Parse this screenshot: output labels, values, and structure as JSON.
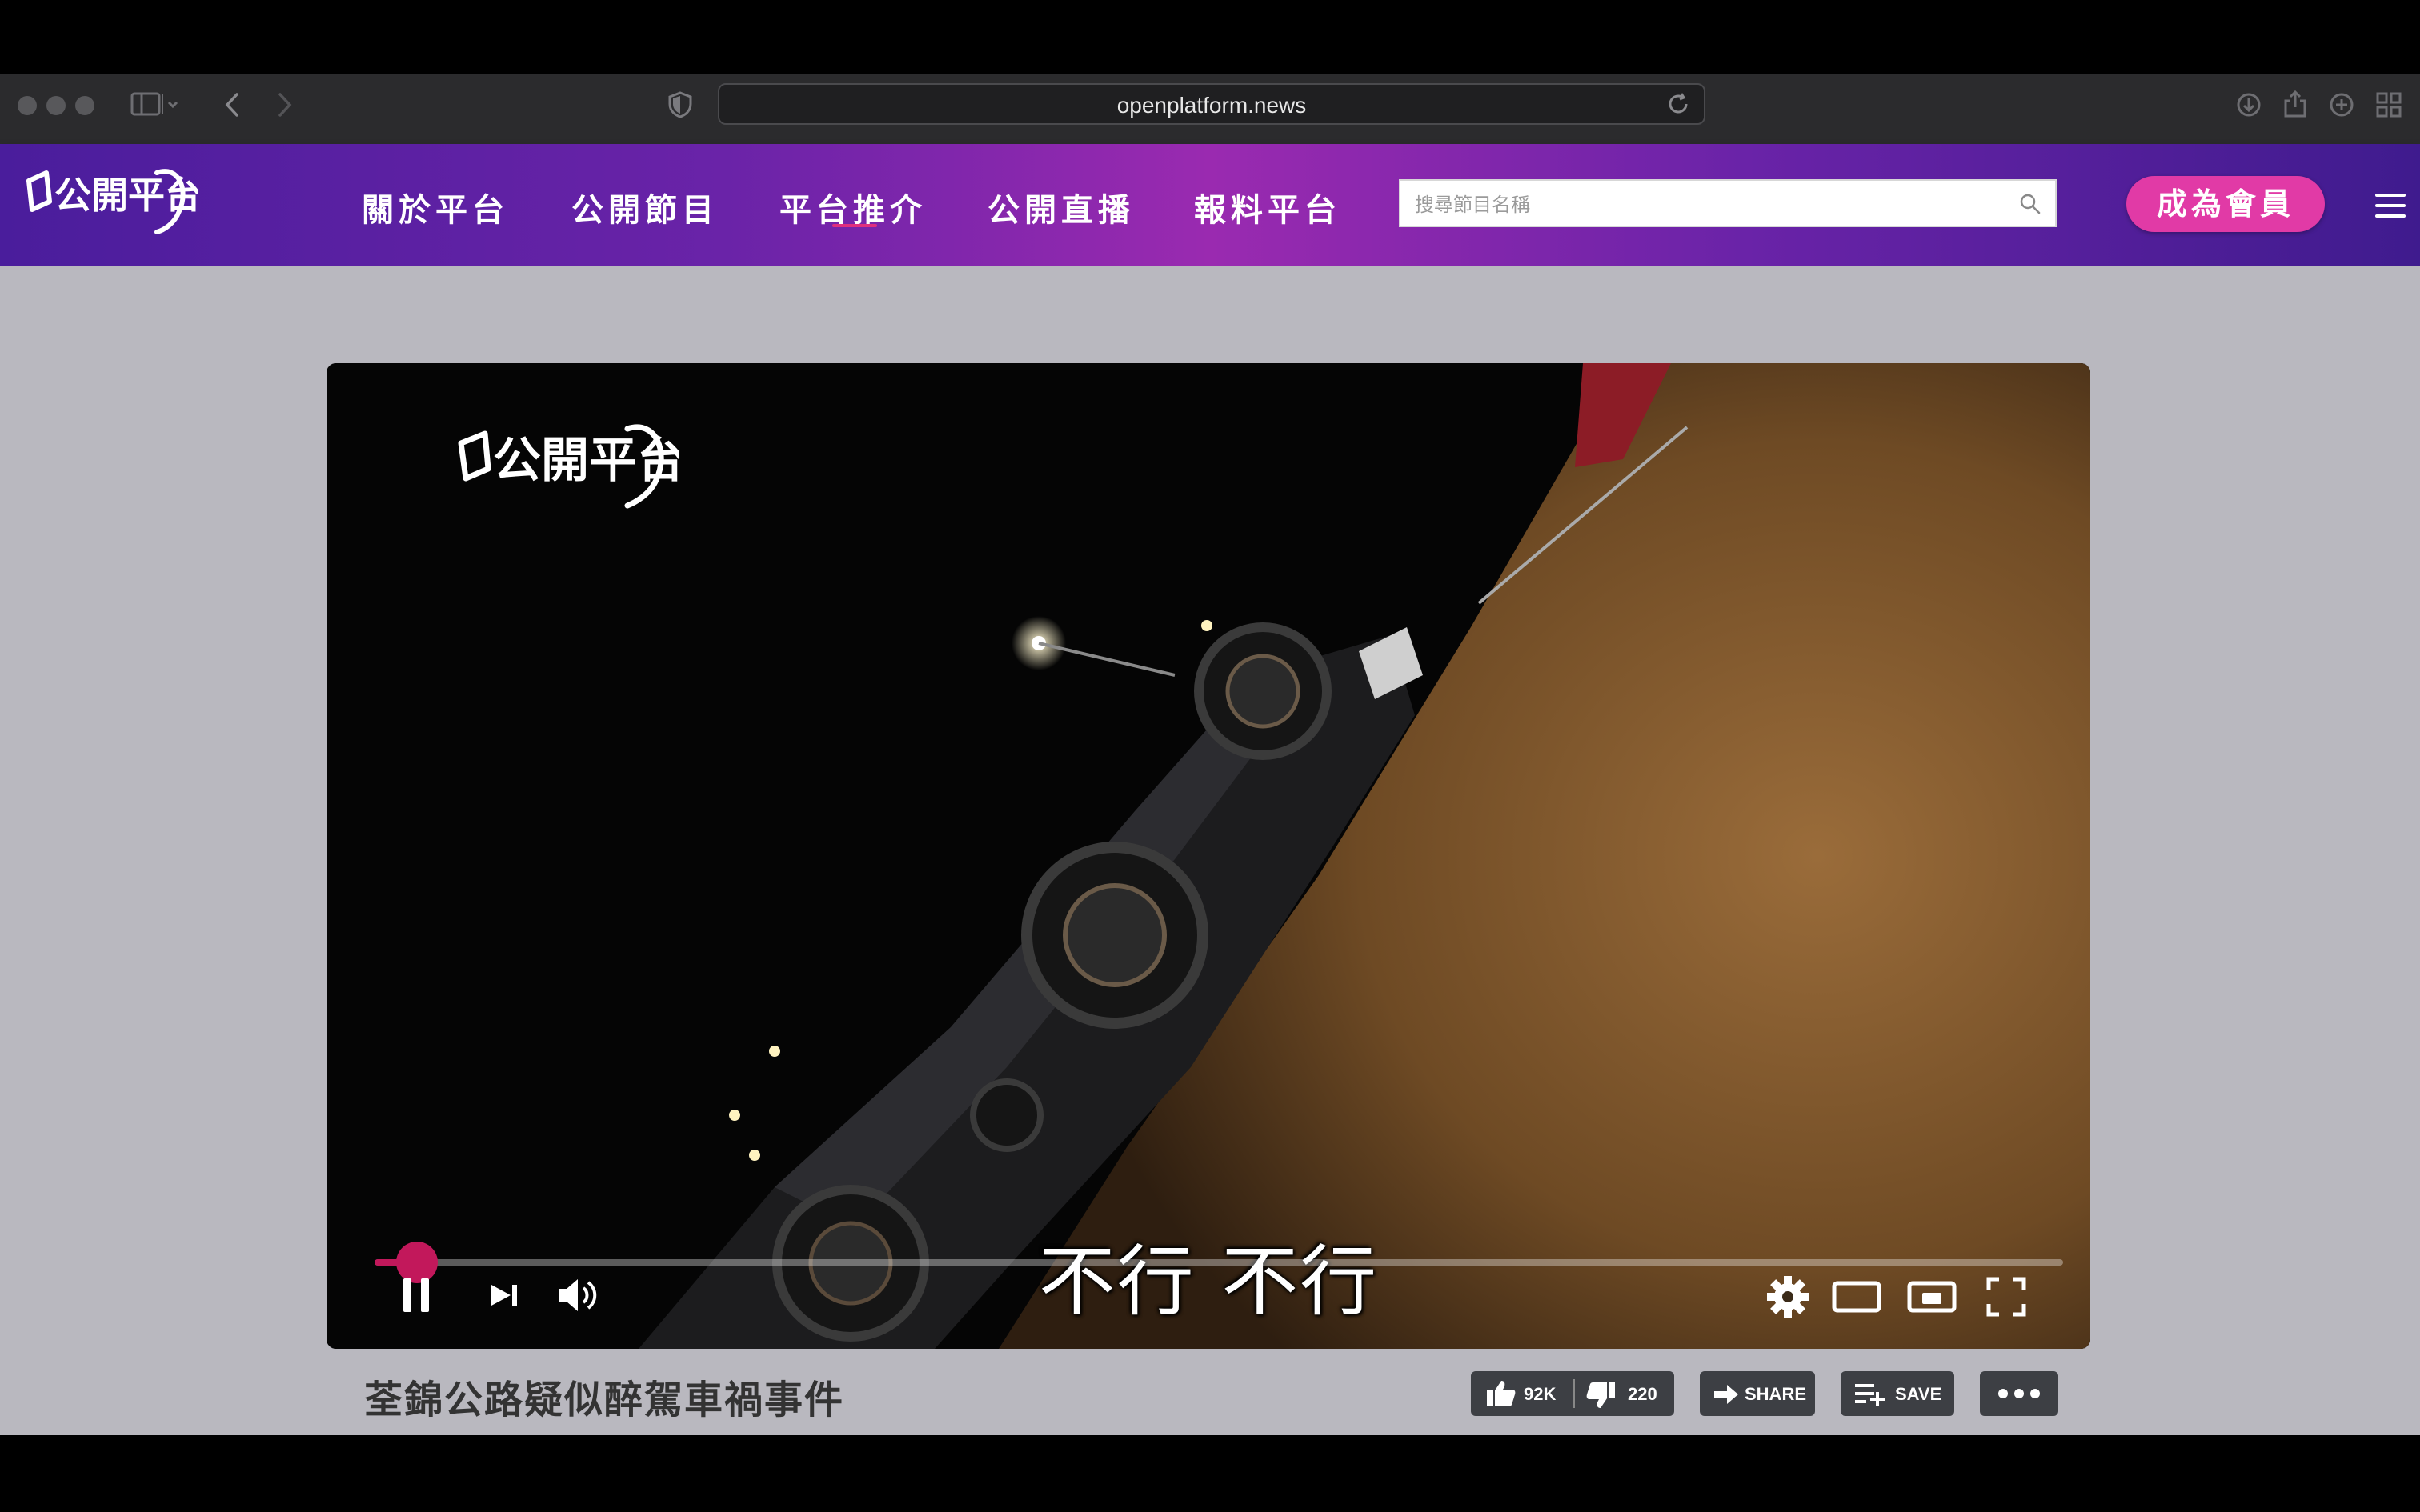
{
  "browser": {
    "url": "openplatform.news"
  },
  "site": {
    "brand": "公開平台",
    "nav": [
      {
        "label": "關於平台"
      },
      {
        "label": "公開節目"
      },
      {
        "label": "平台推介"
      },
      {
        "label": "公開直播"
      },
      {
        "label": "報料平台"
      }
    ],
    "search_placeholder": "搜尋節目名稱",
    "join_label": "成為會員"
  },
  "player": {
    "subtitle": "不行 不行",
    "progress": 0.025,
    "watermark": "公開平台"
  },
  "video": {
    "title": "荃錦公路疑似醉駕車禍事件",
    "likes": "92K",
    "dislikes": "220",
    "share_label": "SHARE",
    "save_label": "SAVE"
  },
  "colors": {
    "accent": "#c2185b",
    "join_button": "#e13aa6",
    "header_gradient_mid": "#9a2ab0"
  }
}
